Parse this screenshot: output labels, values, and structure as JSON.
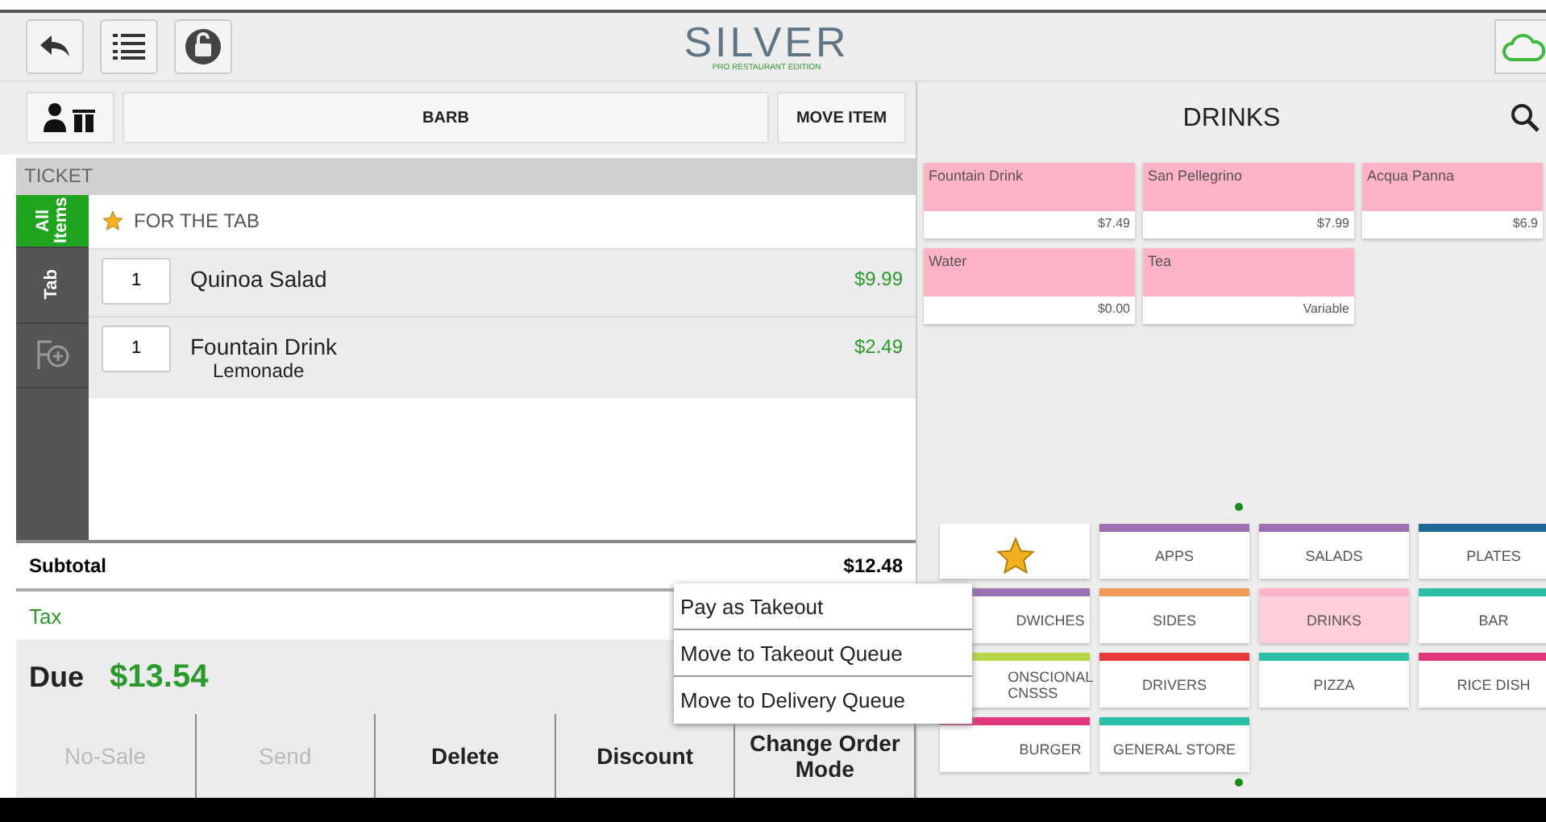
{
  "logo": {
    "name": "SILVER",
    "edition": "PRO RESTAURANT EDITION"
  },
  "order_bar": {
    "customer": "BARB",
    "move_button": "MOVE ITEM"
  },
  "category_title": "DRINKS",
  "ticket": {
    "header": "TICKET",
    "group": "FOR THE TAB",
    "side_tabs": [
      {
        "kind": "text",
        "label": "All Items",
        "selected": true
      },
      {
        "kind": "text",
        "label": "Tab",
        "selected": false
      },
      {
        "kind": "icon",
        "selected": false
      }
    ],
    "items": [
      {
        "qty": "1",
        "name": "Quinoa Salad",
        "price": "$9.99"
      },
      {
        "qty": "1",
        "name": "Fountain Drink",
        "modifier": "Lemonade",
        "price": "$2.49"
      }
    ]
  },
  "totals": {
    "subtotal_label": "Subtotal",
    "subtotal": "$12.48",
    "tax_label": "Tax",
    "due_label": "Due",
    "due": "$13.54"
  },
  "actions": [
    {
      "label": "No-Sale",
      "disabled": true
    },
    {
      "label": "Send",
      "disabled": true
    },
    {
      "label": "Delete",
      "disabled": false
    },
    {
      "label": "Discount",
      "disabled": false
    },
    {
      "label": "Change Order Mode",
      "disabled": false
    }
  ],
  "menu": [
    "Pay as Takeout",
    "Move to Takeout Queue",
    "Move to Delivery Queue"
  ],
  "items": [
    {
      "name": "Fountain Drink",
      "price": "$7.49"
    },
    {
      "name": "San Pellegrino",
      "price": "$7.99"
    },
    {
      "name": "Acqua Panna",
      "price": "$6.9"
    },
    {
      "name": "Water",
      "price": "$0.00"
    },
    {
      "name": "Tea",
      "price": "Variable"
    }
  ],
  "categories": [
    {
      "kind": "favorites",
      "selected": false
    },
    {
      "kind": "text",
      "label": "APPS",
      "color": "#9b6fb0",
      "selected": false
    },
    {
      "kind": "text",
      "label": "SALADS",
      "color": "#9b6fb0",
      "selected": false
    },
    {
      "kind": "text",
      "label": "PLATES",
      "color": "#1f6a9a",
      "selected": false
    },
    {
      "kind": "text",
      "label": "DWICHES",
      "color": "#9b6fb0",
      "selected": false
    },
    {
      "kind": "text",
      "label": "SIDES",
      "color": "#f29a5a",
      "selected": false
    },
    {
      "kind": "text",
      "label": "DRINKS",
      "color": "#ffb3c6",
      "selected": true
    },
    {
      "kind": "text",
      "label": "BAR",
      "color": "#2bbfaa",
      "selected": false
    },
    {
      "kind": "text",
      "label": "ONSCIONAL CNSSS",
      "color": "#b8d84a",
      "selected": false
    },
    {
      "kind": "text",
      "label": "DRIVERS",
      "color": "#e8383b",
      "selected": false
    },
    {
      "kind": "text",
      "label": "PIZZA",
      "color": "#2bbfaa",
      "selected": false
    },
    {
      "kind": "text",
      "label": "RICE DISH",
      "color": "#e0387a",
      "selected": false
    },
    {
      "kind": "text",
      "label": "BURGER",
      "color": "#e0387a",
      "selected": false
    },
    {
      "kind": "text",
      "label": "GENERAL STORE",
      "color": "#2bbfaa",
      "selected": false
    }
  ]
}
